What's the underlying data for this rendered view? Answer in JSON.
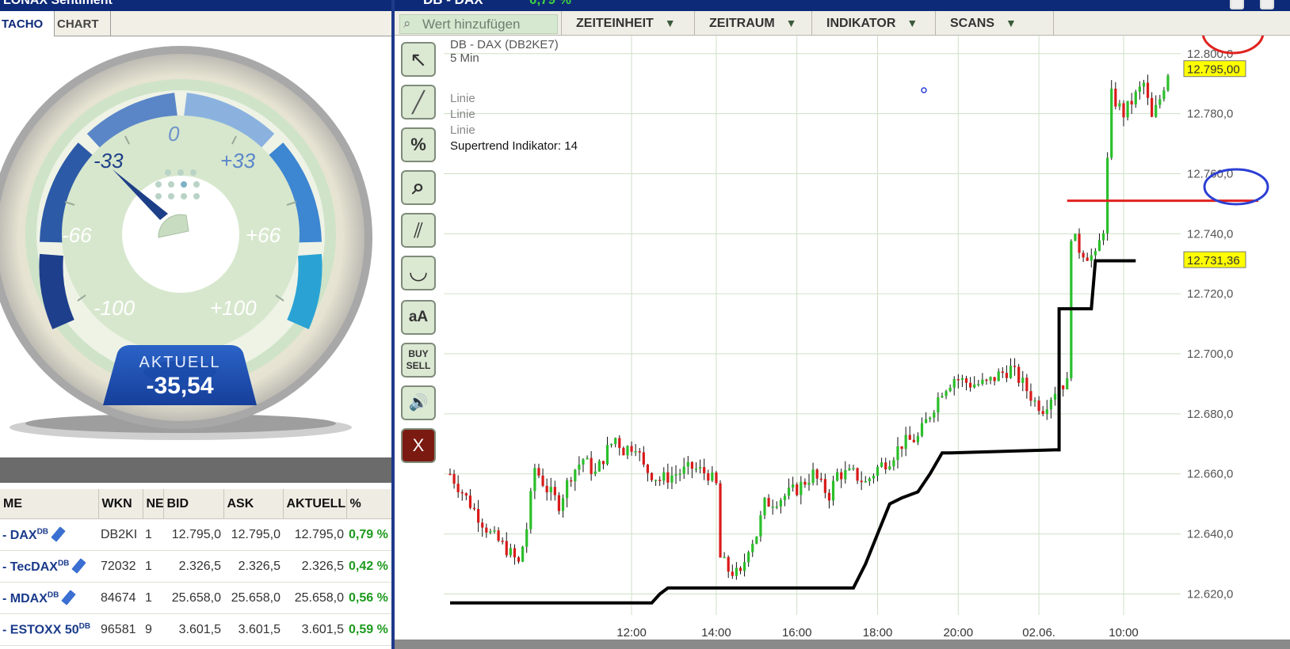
{
  "left_panel": {
    "title": "LONAX Sentiment",
    "tabs": [
      {
        "label": "TACHO",
        "active": true
      },
      {
        "label": "CHART",
        "active": false
      }
    ],
    "gauge": {
      "labels": [
        "-100",
        "-66",
        "-33",
        "0",
        "+33",
        "+66",
        "+100"
      ],
      "value": -35.54,
      "aktuell_label": "AKTUELL",
      "aktuell_value": "-35,54"
    },
    "table": {
      "columns": [
        "ME",
        "WKN",
        "NE",
        "BID",
        "ASK",
        "AKTUELL",
        "%"
      ],
      "rows": [
        {
          "name": "- DAX",
          "sup": "DB",
          "wkn": "DB2KI",
          "ne": "1",
          "bid": "12.795,0",
          "ask": "12.795,0",
          "aktuell": "12.795,0",
          "pct": "0,79 %"
        },
        {
          "name": "- TecDAX",
          "sup": "DB",
          "wkn": "72032",
          "ne": "1",
          "bid": "2.326,5",
          "ask": "2.326,5",
          "aktuell": "2.326,5",
          "pct": "0,42 %"
        },
        {
          "name": "- MDAX",
          "sup": "DB",
          "wkn": "84674",
          "ne": "1",
          "bid": "25.658,0",
          "ask": "25.658,0",
          "aktuell": "25.658,0",
          "pct": "0,56 %"
        },
        {
          "name": "- ESTOXX 50",
          "sup": "DB",
          "wkn": "96581",
          "ne": "9",
          "bid": "3.601,5",
          "ask": "3.601,5",
          "aktuell": "3.601,5",
          "pct": "0,59 %"
        }
      ]
    }
  },
  "chart_window": {
    "title": "DB - DAX",
    "change": "0,79 %",
    "toolbar": {
      "search_placeholder": "Wert hinzufügen",
      "menus": [
        "ZEITEINHEIT",
        "ZEITRAUM",
        "INDIKATOR",
        "SCANS"
      ]
    },
    "tools": [
      {
        "icon": "cursor-icon",
        "glyph": "↖"
      },
      {
        "icon": "line-draw-icon",
        "glyph": "╱"
      },
      {
        "icon": "percent-icon",
        "glyph": "%"
      },
      {
        "icon": "zoom-icon",
        "glyph": "⌕"
      },
      {
        "icon": "parallel-lines-icon",
        "glyph": "⫽"
      },
      {
        "icon": "curve-icon",
        "glyph": "◡"
      },
      {
        "icon": "text-size-icon",
        "glyph": "aA"
      },
      {
        "icon": "buy-sell-icon",
        "glyph": "BUY SELL"
      },
      {
        "icon": "speaker-icon",
        "glyph": "🔊"
      },
      {
        "icon": "close-icon",
        "glyph": "X"
      }
    ],
    "colors": {
      "up": "#2bbf2b",
      "down": "#d91a1a",
      "supertrend": "#000000",
      "price_label_bg": "#ffff00",
      "annotation_red": "#e0221f",
      "annotation_blue": "#2b3fd3"
    }
  },
  "chart_data": {
    "type": "candlestick",
    "title": "DB - DAX (DB2KE7)",
    "subtitle": "5 Min",
    "legend": [
      "Linie",
      "Linie",
      "Linie",
      "Supertrend Indikator: 14"
    ],
    "x_ticks": [
      "12:00",
      "14:00",
      "16:00",
      "18:00",
      "20:00",
      "02.06.",
      "10:00"
    ],
    "y_ticks": [
      "12.620,0",
      "12.640,0",
      "12.660,0",
      "12.680,0",
      "12.700,0",
      "12.720,0",
      "12.740,0",
      "12.760,0",
      "12.780,0",
      "12.800,0"
    ],
    "ylim": [
      12613,
      12806
    ],
    "price_labels": {
      "last": "12.795,00",
      "supertrend": "12.731,36"
    },
    "horizontal_line": 12751,
    "close_path": [
      [
        0,
        12660
      ],
      [
        6,
        12648
      ],
      [
        10,
        12640
      ],
      [
        14,
        12635
      ],
      [
        17,
        12630
      ],
      [
        19,
        12642
      ],
      [
        21,
        12662
      ],
      [
        24,
        12655
      ],
      [
        27,
        12650
      ],
      [
        30,
        12660
      ],
      [
        33,
        12665
      ],
      [
        36,
        12660
      ],
      [
        39,
        12668
      ],
      [
        41,
        12672
      ],
      [
        43,
        12668
      ],
      [
        46,
        12670
      ],
      [
        48,
        12662
      ],
      [
        52,
        12658
      ],
      [
        56,
        12660
      ],
      [
        60,
        12662
      ],
      [
        64,
        12660
      ],
      [
        66,
        12656
      ],
      [
        67,
        12632
      ],
      [
        69,
        12628
      ],
      [
        72,
        12626
      ],
      [
        74,
        12636
      ],
      [
        76,
        12640
      ],
      [
        78,
        12650
      ],
      [
        82,
        12652
      ],
      [
        86,
        12655
      ],
      [
        90,
        12660
      ],
      [
        92,
        12656
      ],
      [
        94,
        12653
      ],
      [
        96,
        12660
      ],
      [
        100,
        12660
      ],
      [
        103,
        12657
      ],
      [
        106,
        12662
      ],
      [
        109,
        12665
      ],
      [
        112,
        12670
      ],
      [
        116,
        12672
      ],
      [
        119,
        12680
      ],
      [
        122,
        12688
      ],
      [
        125,
        12692
      ],
      [
        129,
        12690
      ],
      [
        133,
        12690
      ],
      [
        136,
        12693
      ],
      [
        139,
        12695
      ],
      [
        142,
        12690
      ],
      [
        145,
        12684
      ],
      [
        147,
        12682
      ],
      [
        149,
        12686
      ],
      [
        151,
        12690
      ],
      [
        153,
        12690
      ],
      [
        154,
        12740
      ],
      [
        156,
        12735
      ],
      [
        158,
        12733
      ],
      [
        160,
        12732
      ],
      [
        162,
        12742
      ],
      [
        164,
        12786
      ],
      [
        167,
        12780
      ],
      [
        170,
        12786
      ],
      [
        172,
        12790
      ],
      [
        174,
        12778
      ],
      [
        176,
        12785
      ],
      [
        178,
        12794
      ]
    ],
    "candle_count": 179,
    "supertrend_steps": [
      [
        0,
        12617
      ],
      [
        50,
        12617
      ],
      [
        52,
        12620
      ],
      [
        54,
        12622
      ],
      [
        100,
        12622
      ],
      [
        103,
        12630
      ],
      [
        106,
        12640
      ],
      [
        109,
        12650
      ],
      [
        112,
        12652
      ],
      [
        116,
        12654
      ],
      [
        119,
        12660
      ],
      [
        122,
        12667
      ],
      [
        124,
        12667
      ],
      [
        150,
        12668
      ],
      [
        151,
        12668
      ],
      [
        151,
        12715
      ],
      [
        159,
        12715
      ],
      [
        160,
        12731
      ],
      [
        170,
        12731
      ]
    ]
  }
}
